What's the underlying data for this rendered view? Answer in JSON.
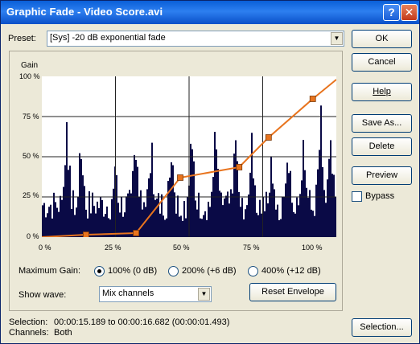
{
  "window": {
    "title": "Graphic Fade - Video Score.avi",
    "help_glyph": "?",
    "close_glyph": "✕"
  },
  "preset": {
    "label": "Preset:",
    "value": "[Sys] -20 dB exponential fade"
  },
  "graph": {
    "gain_label": "Gain",
    "y_ticks": [
      "100 %",
      "75 %",
      "50 %",
      "25 %",
      "0 %"
    ],
    "x_ticks": [
      "0 %",
      "25 %",
      "50 %",
      "75 %",
      "100 %"
    ],
    "envelope_color": "#e8741e",
    "waveform_color": "#0a0a46",
    "envelope_points": [
      {
        "x": 0,
        "y": 0
      },
      {
        "x": 15,
        "y": 1.5
      },
      {
        "x": 32,
        "y": 2.5
      },
      {
        "x": 47,
        "y": 37
      },
      {
        "x": 67,
        "y": 43.5
      },
      {
        "x": 77,
        "y": 62
      },
      {
        "x": 92,
        "y": 86
      },
      {
        "x": 100,
        "y": 98
      }
    ]
  },
  "max_gain": {
    "label": "Maximum Gain:",
    "options": [
      "100% (0 dB)",
      "200% (+6 dB)",
      "400% (+12 dB)"
    ],
    "selected": 0
  },
  "show_wave": {
    "label": "Show wave:",
    "value": "Mix channels"
  },
  "reset_envelope_label": "Reset Envelope",
  "buttons": {
    "ok": "OK",
    "cancel": "Cancel",
    "help": "Help",
    "save_as": "Save As...",
    "delete": "Delete",
    "preview": "Preview",
    "selection": "Selection..."
  },
  "bypass": {
    "label": "Bypass",
    "checked": false
  },
  "status": {
    "selection_label": "Selection:",
    "selection_value": "00:00:15.189 to 00:00:16.682 (00:00:01.493)",
    "channels_label": "Channels:",
    "channels_value": "Both"
  }
}
